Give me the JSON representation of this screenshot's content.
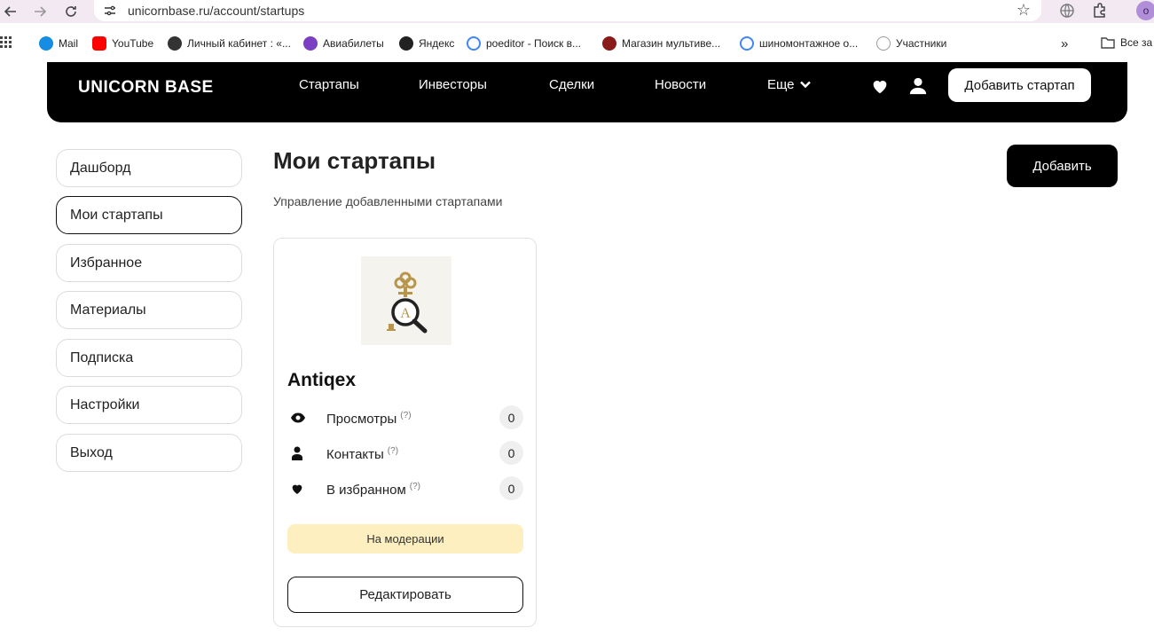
{
  "browser": {
    "url": "unicornbase.ru/account/startups",
    "profile_initial": "o",
    "bookmarks": [
      {
        "label": "Mail",
        "color": "#168de2"
      },
      {
        "label": "YouTube",
        "color": "#ff0000"
      },
      {
        "label": "Личный кабинет : «...",
        "color": "#333333"
      },
      {
        "label": "Авиабилеты",
        "color": "#7b3fc4"
      },
      {
        "label": "Яндекс",
        "color": "#222222"
      },
      {
        "label": "poeditor - Поиск в...",
        "color": "#4285f4"
      },
      {
        "label": "Магазин мультиве...",
        "color": "#8b1a1a"
      },
      {
        "label": "шиномонтажное о...",
        "color": "#4285f4"
      },
      {
        "label": "Участники",
        "color": "#999999"
      }
    ],
    "bookmarks_more": "»",
    "all_bookmarks": "Все за"
  },
  "header": {
    "logo": "UNICORN BASE",
    "menu": [
      "Стартапы",
      "Инвесторы",
      "Сделки",
      "Новости"
    ],
    "more": "Еще",
    "add_startup": "Добавить стартап"
  },
  "sidebar": {
    "items": [
      {
        "label": "Дашборд"
      },
      {
        "label": "Мои стартапы",
        "active": true
      },
      {
        "label": "Избранное"
      },
      {
        "label": "Материалы"
      },
      {
        "label": "Подписка"
      },
      {
        "label": "Настройки"
      },
      {
        "label": "Выход"
      }
    ]
  },
  "main": {
    "title": "Мои стартапы",
    "subtitle": "Управление добавленными стартапами",
    "add_button": "Добавить"
  },
  "card": {
    "logo_letter": "A",
    "name": "Antiqex",
    "stats": [
      {
        "label": "Просмотры",
        "hint": "(?)",
        "count": "0",
        "icon": "eye-icon"
      },
      {
        "label": "Контакты",
        "hint": "(?)",
        "count": "0",
        "icon": "user-icon"
      },
      {
        "label": "В избранном",
        "hint": "(?)",
        "count": "0",
        "icon": "heart-icon"
      }
    ],
    "status": "На модерации",
    "edit_button": "Редактировать"
  },
  "colors": {
    "header_bg": "#000000",
    "moderation_bg": "#fdefc0",
    "accent": "#000000"
  }
}
